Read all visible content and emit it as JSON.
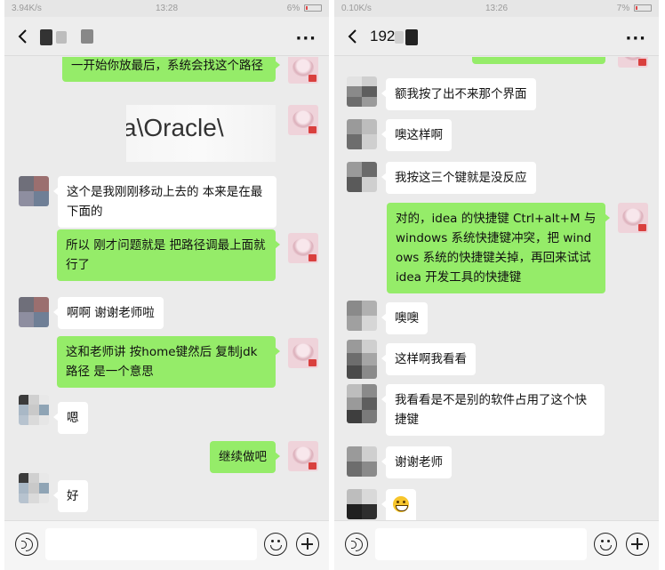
{
  "left": {
    "status": {
      "net": "3.94K/s",
      "time": "13:28",
      "battery": "6%"
    },
    "messages": {
      "m1": "一开始你放最后，系统会找这个路径",
      "m2_image_text": "a\\Oracle\\",
      "m3": "这个是我刚刚移动上去的  本来是在最下面的",
      "m4": "所以  刚才问题就是 把路径调最上面就行了",
      "m5": "啊啊  谢谢老师啦",
      "m6": "这和老师讲 按home键然后 复制jdk路径 是一个意思",
      "m7": "嗯",
      "m8": "继续做吧",
      "m9": "好"
    }
  },
  "right": {
    "status": {
      "net": "0.10K/s",
      "time": "13:26",
      "battery": "7%"
    },
    "title": "192",
    "messages": {
      "m1": "额我按了出不来那个界面",
      "m2": "噢这样啊",
      "m3": "我按这三个键就是没反应",
      "m4": "对的，idea 的快捷键 Ctrl+alt+M 与 windows 系统快捷键冲突，把 windows 系统的快捷键关掉，再回来试试 idea 开发工具的快捷键",
      "m5": "噢噢",
      "m6": "这样啊我看看",
      "m7": "我看看是不是别的软件占用了这个快捷键",
      "m8": "谢谢老师"
    }
  },
  "icons": {
    "back": "chevron-left-icon",
    "more": "more-dots-icon",
    "voice": "voice-icon",
    "emoji": "smile-icon",
    "plus": "plus-icon"
  },
  "colors": {
    "chat_bg": "#ebebeb",
    "sent_bubble": "#95ec69",
    "recv_bubble": "#ffffff"
  }
}
